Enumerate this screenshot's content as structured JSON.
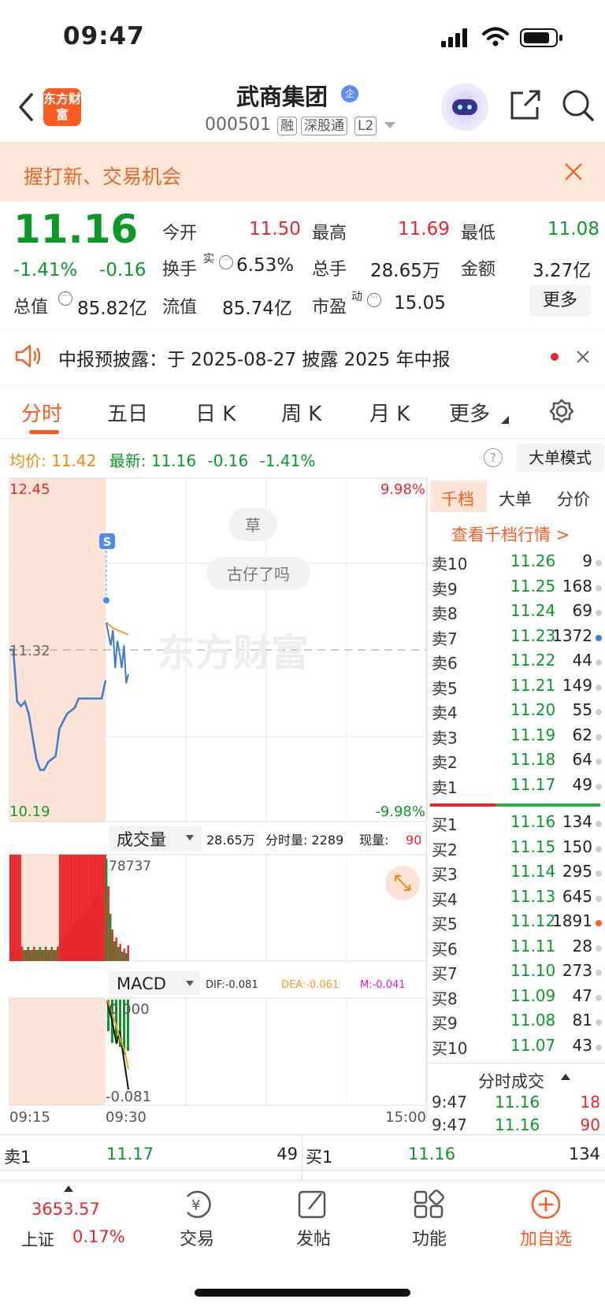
{
  "status_bar": {
    "time": "09:47"
  },
  "header": {
    "logo_text": "东方财富",
    "stock_name": "武商集团",
    "corp_badge": "企",
    "stock_code": "000501",
    "tags": [
      "融",
      "深股通",
      "L2"
    ]
  },
  "banner": {
    "text": "握打新、交易机会"
  },
  "quote": {
    "price": "11.16",
    "change_pct": "-1.41%",
    "change": "-0.16",
    "cap_label": "总值",
    "cap_value": "85.82亿",
    "fields": [
      {
        "label": "今开",
        "value": "11.50",
        "color": "red"
      },
      {
        "label": "最高",
        "value": "11.69",
        "color": "red"
      },
      {
        "label": "最低",
        "value": "11.08",
        "color": "green"
      },
      {
        "label": "换手",
        "sup": "实",
        "value": "6.53%",
        "color": "black"
      },
      {
        "label": "总手",
        "value": "28.65万",
        "color": "black"
      },
      {
        "label": "金额",
        "value": "3.27亿",
        "color": "black"
      },
      {
        "label": "流值",
        "value": "85.74亿",
        "color": "black"
      },
      {
        "label": "市盈",
        "sup": "动",
        "value": "15.05",
        "color": "black"
      }
    ],
    "more_label": "更多"
  },
  "notice": {
    "text": "中报预披露：于 2025-08-27 披露 2025 年中报"
  },
  "tabs": [
    "分时",
    "五日",
    "日 K",
    "周 K",
    "月 K",
    "更多"
  ],
  "chart_header": {
    "avg_label": "均价:",
    "avg_value": "11.42",
    "latest_label": "最新:",
    "latest_value": "11.16",
    "latest_change": "-0.16",
    "latest_pct": "-1.41%",
    "big_order_mode": "大单模式"
  },
  "chart_data": {
    "type": "line",
    "y_top_label": "12.45",
    "y_bottom_label": "10.19",
    "pct_top": "9.98%",
    "pct_bottom": "-9.98%",
    "ref_price": "11.32",
    "x_labels": [
      "09:15",
      "09:30",
      "15:00"
    ],
    "ylim": [
      10.19,
      12.45
    ],
    "bubbles": [
      "草",
      "古仔了吗"
    ],
    "signal_badge": "S",
    "watermark": "东方财富",
    "auction_series": [
      11.32,
      11.32,
      10.98,
      10.95,
      10.98,
      10.9,
      10.75,
      10.6,
      10.53,
      10.53,
      10.58,
      10.6,
      10.62,
      10.8,
      10.85,
      10.9,
      10.92,
      10.94,
      11.0,
      11.0,
      11.0,
      11.0,
      11.0,
      11.0,
      11.0,
      11.12
    ],
    "trade_series": [
      11.5,
      11.42,
      11.35,
      11.45,
      11.2,
      11.38,
      11.3,
      11.2,
      11.35,
      11.1,
      11.16
    ],
    "avg_series": [
      11.5,
      11.48,
      11.46,
      11.45,
      11.44,
      11.43,
      11.42
    ]
  },
  "volume_panel": {
    "label": "成交量",
    "total": "28.65万",
    "tick_label": "分时量: 2289",
    "now_label": "现量:",
    "now_value": "90",
    "max_label": "78737"
  },
  "macd_panel": {
    "label": "MACD",
    "dif": "DIF:-0.081",
    "dea": "DEA:-0.061",
    "m": "M:-0.041",
    "top_label": "0.000",
    "bottom_label": "-0.081"
  },
  "order_book": {
    "tabs": [
      "千档",
      "大单",
      "分价"
    ],
    "link": "查看千档行情 >",
    "asks": [
      {
        "label": "卖10",
        "price": "11.26",
        "vol": "9",
        "dot": "gray"
      },
      {
        "label": "卖9",
        "price": "11.25",
        "vol": "168",
        "dot": "gray"
      },
      {
        "label": "卖8",
        "price": "11.24",
        "vol": "69",
        "dot": "gray"
      },
      {
        "label": "卖7",
        "price": "11.23",
        "vol": "1372",
        "dot": "blue"
      },
      {
        "label": "卖6",
        "price": "11.22",
        "vol": "44",
        "dot": "gray"
      },
      {
        "label": "卖5",
        "price": "11.21",
        "vol": "149",
        "dot": "gray"
      },
      {
        "label": "卖4",
        "price": "11.20",
        "vol": "55",
        "dot": "gray"
      },
      {
        "label": "卖3",
        "price": "11.19",
        "vol": "62",
        "dot": "gray"
      },
      {
        "label": "卖2",
        "price": "11.18",
        "vol": "64",
        "dot": "gray"
      },
      {
        "label": "卖1",
        "price": "11.17",
        "vol": "49",
        "dot": "gray"
      }
    ],
    "bids": [
      {
        "label": "买1",
        "price": "11.16",
        "vol": "134",
        "dot": "gray"
      },
      {
        "label": "买2",
        "price": "11.15",
        "vol": "150",
        "dot": "gray"
      },
      {
        "label": "买3",
        "price": "11.14",
        "vol": "295",
        "dot": "gray"
      },
      {
        "label": "买4",
        "price": "11.13",
        "vol": "645",
        "dot": "gray"
      },
      {
        "label": "买5",
        "price": "11.12",
        "vol": "1891",
        "dot": "orange"
      },
      {
        "label": "买6",
        "price": "11.11",
        "vol": "28",
        "dot": "gray"
      },
      {
        "label": "买7",
        "price": "11.10",
        "vol": "273",
        "dot": "gray"
      },
      {
        "label": "买8",
        "price": "11.09",
        "vol": "47",
        "dot": "gray"
      },
      {
        "label": "买9",
        "price": "11.08",
        "vol": "81",
        "dot": "gray"
      },
      {
        "label": "买10",
        "price": "11.07",
        "vol": "43",
        "dot": "gray"
      }
    ],
    "trades_title": "分时成交",
    "trades": [
      {
        "time": "9:47",
        "price": "11.16",
        "vol": "18"
      },
      {
        "time": "9:47",
        "price": "11.16",
        "vol": "90"
      }
    ]
  },
  "quick_bar": {
    "sell_label": "卖1",
    "sell_price": "11.17",
    "sell_vol": "49",
    "buy_label": "买1",
    "buy_price": "11.16",
    "buy_vol": "134"
  },
  "bottom_nav": {
    "index_value": "3653.57",
    "index_name": "上证",
    "index_pct": "0.17%",
    "items": [
      "交易",
      "发帖",
      "功能",
      "加自选"
    ]
  }
}
